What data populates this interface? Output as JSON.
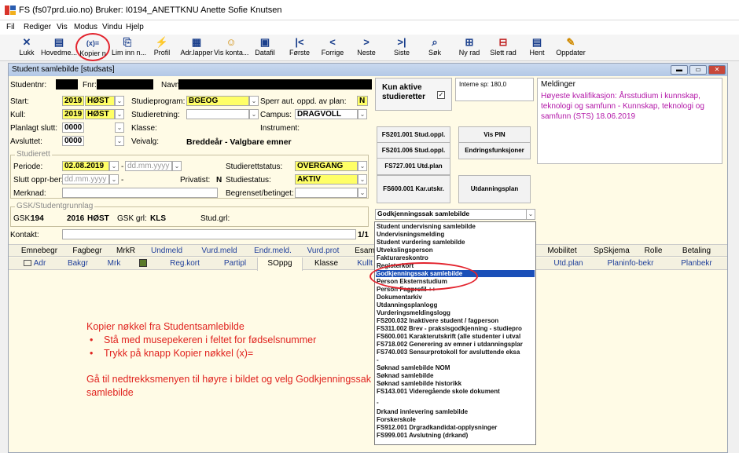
{
  "title_bar": {
    "text": "FS (fs07prd.uio.no) Bruker: I0194_ANETTKNU Anette Sofie Knutsen"
  },
  "menu": [
    "Fil",
    "Rediger",
    "Vis",
    "Modus",
    "Vindu",
    "Hjelp"
  ],
  "toolbar": [
    {
      "label": "Lukk",
      "icon": "close-icon",
      "glyph": "✕"
    },
    {
      "label": "Hovedme...",
      "icon": "main-menu-icon",
      "glyph": "▤"
    },
    {
      "label": "Kopier n",
      "icon": "copy-key-icon",
      "glyph": "(x)="
    },
    {
      "label": "Lim inn n...",
      "icon": "paste-key-icon",
      "glyph": "⎘"
    },
    {
      "label": "Profil",
      "icon": "profile-icon",
      "glyph": "⚡"
    },
    {
      "label": "Adr.lapper",
      "icon": "address-labels-icon",
      "glyph": "▦"
    },
    {
      "label": "Vis konta...",
      "icon": "contact-icon",
      "glyph": "☺"
    },
    {
      "label": "Datafil",
      "icon": "datafile-icon",
      "glyph": "▣"
    },
    {
      "label": "Første",
      "icon": "first-icon",
      "glyph": "|<"
    },
    {
      "label": "Forrige",
      "icon": "previous-icon",
      "glyph": "<"
    },
    {
      "label": "Neste",
      "icon": "next-icon",
      "glyph": ">"
    },
    {
      "label": "Siste",
      "icon": "last-icon",
      "glyph": ">|"
    },
    {
      "label": "Søk",
      "icon": "search-icon",
      "glyph": "⌕"
    },
    {
      "label": "Ny rad",
      "icon": "new-row-icon",
      "glyph": "⊞"
    },
    {
      "label": "Slett rad",
      "icon": "delete-row-icon",
      "glyph": "⊟"
    },
    {
      "label": "Hent",
      "icon": "fetch-icon",
      "glyph": "▤"
    },
    {
      "label": "Oppdater",
      "icon": "update-icon",
      "glyph": "✎"
    }
  ],
  "window": {
    "title": "Student samlebilde  [studsats]",
    "labels": {
      "studentnr": "Studentnr:",
      "fnr": "Fnr:",
      "navn": "Navn",
      "start": "Start:",
      "kull": "Kull:",
      "planlagt": "Planlagt slutt:",
      "avsluttet": "Avsluttet:",
      "studieprogram": "Studieprogram:",
      "studieretning": "Studieretning:",
      "klasse": "Klasse:",
      "veivalg": "Veivalg:",
      "sperr": "Sperr aut. oppd. av plan:",
      "campus": "Campus:",
      "instrument": "Instrument:",
      "kun_aktive": "Kun aktive studieretter",
      "interne_sp": "Interne sp: 180,0",
      "meldinger": "Meldinger"
    },
    "values": {
      "start_year": "2019",
      "start_term": "HØST",
      "kull_year": "2019",
      "kull_term": "HØST",
      "planlagt": "0000",
      "avsluttet": "0000",
      "studieprogram": "BGEOG",
      "sperr": "N",
      "campus": "DRAGVOLL",
      "veivalg": "Breddeår - Valgbare emner"
    },
    "melding_text": "Høyeste kvalifikasjon: Årsstudium i kunnskap, teknologi og samfunn - Kunnskap, teknologi og samfunn (STS) 18.06.2019",
    "studierett": {
      "legend": "Studierett",
      "periode_label": "Periode:",
      "periode_from": "02.08.2019",
      "periode_to": "dd.mm.yyyy",
      "slutt_label": "Slutt oppr-ber:",
      "slutt_value": "dd.mm.yyyy",
      "slutt_dash": "-",
      "merknad_label": "Merknad:",
      "privatist_label": "Privatist:",
      "privatist_value": "N",
      "status_label": "Studierettstatus:",
      "status_value": "OVERGANG",
      "studiestatus_label": "Studiestatus:",
      "studiestatus_value": "AKTIV",
      "begrenset_label": "Begrenset/betinget:"
    },
    "gsk": {
      "legend": "GSK/Studentgrunnlag",
      "gsk_label": "GSK:",
      "gsk_value": "194",
      "gsk_year": "2016",
      "gsk_term": "HØST",
      "grl_label": "GSK grl:",
      "grl_value": "KLS",
      "stud_grl": "Stud.grl:"
    },
    "kontakt_label": "Kontakt:",
    "page": "1/1",
    "right_buttons": [
      "FS201.001 Stud.oppl.",
      "Vis PIN",
      "FS201.006 Stud.oppl.",
      "Endringsfunksjoner",
      "FS727.001 Utd.plan",
      "FS600.001 Kar.utskr.",
      "Utdanningsplan"
    ],
    "dropdown_selected": "Godkjenningssak samlebilde"
  },
  "tabs_row1": [
    "Emnebegr",
    "Fagbegr",
    "MrkR",
    "Undmeld",
    "Vurd.meld",
    "Endr.meld.",
    "Vurd.prot",
    "Esam",
    "Mobilitet",
    "SpSkjema",
    "Rolle",
    "Betaling"
  ],
  "tabs_row2": [
    "Adr",
    "Bakgr",
    "Mrk",
    "Reg.kort",
    "Partipl",
    "SOppg",
    "Klasse",
    "Kullt",
    "Utd.plan",
    "Planinfo-bekr",
    "Planbekr"
  ],
  "dropdown_items": [
    "Student undervisning samlebilde",
    "Undervisningsmelding",
    "Student vurdering samlebilde",
    "Utvekslingsperson",
    "Fakturareskontro",
    "Registerkort",
    "Godkjenningssak samlebilde",
    "Person Eksternstudium",
    "Person Fagprofil ++",
    "Dokumentarkiv",
    "Utdanningsplanlogg",
    "Vurderingsmeldingslogg",
    "FS200.032 Inaktivere student / fagperson",
    "FS311.002 Brev - praksisgodkjenning - studiepro",
    "FS600.001 Karakterutskrift (alle studenter i utval",
    "FS718.002 Generering av emner i utdanningsplar",
    "FS740.003 Sensurprotokoll for avsluttende eksa",
    "-",
    "Søknad samlebilde NOM",
    "Søknad samlebilde",
    "Søknad samlebilde historikk",
    "FS143.001 Videregående skole dokument",
    "-",
    "Drkand innlevering samlebilde",
    "Forskerskole",
    "FS912.001 Drgradkandidat-opplysninger",
    "FS999.001 Avslutning (drkand)"
  ],
  "instructions": {
    "heading": "Kopier nøkkel fra Studentsamlebilde",
    "bullets": [
      "Stå med musepekeren i feltet for fødselsnummer",
      "Trykk på knapp Kopier nøkkel (x)="
    ],
    "footer": "Gå til nedtrekksmenyen til høyre i bildet og velg Godkjenningssak samlebilde"
  },
  "colors": {
    "highlight_yellow": "#ffff66",
    "selection_blue": "#1a4fb8",
    "annotation_red": "#e3232d",
    "form_bg": "#fffbe6"
  }
}
